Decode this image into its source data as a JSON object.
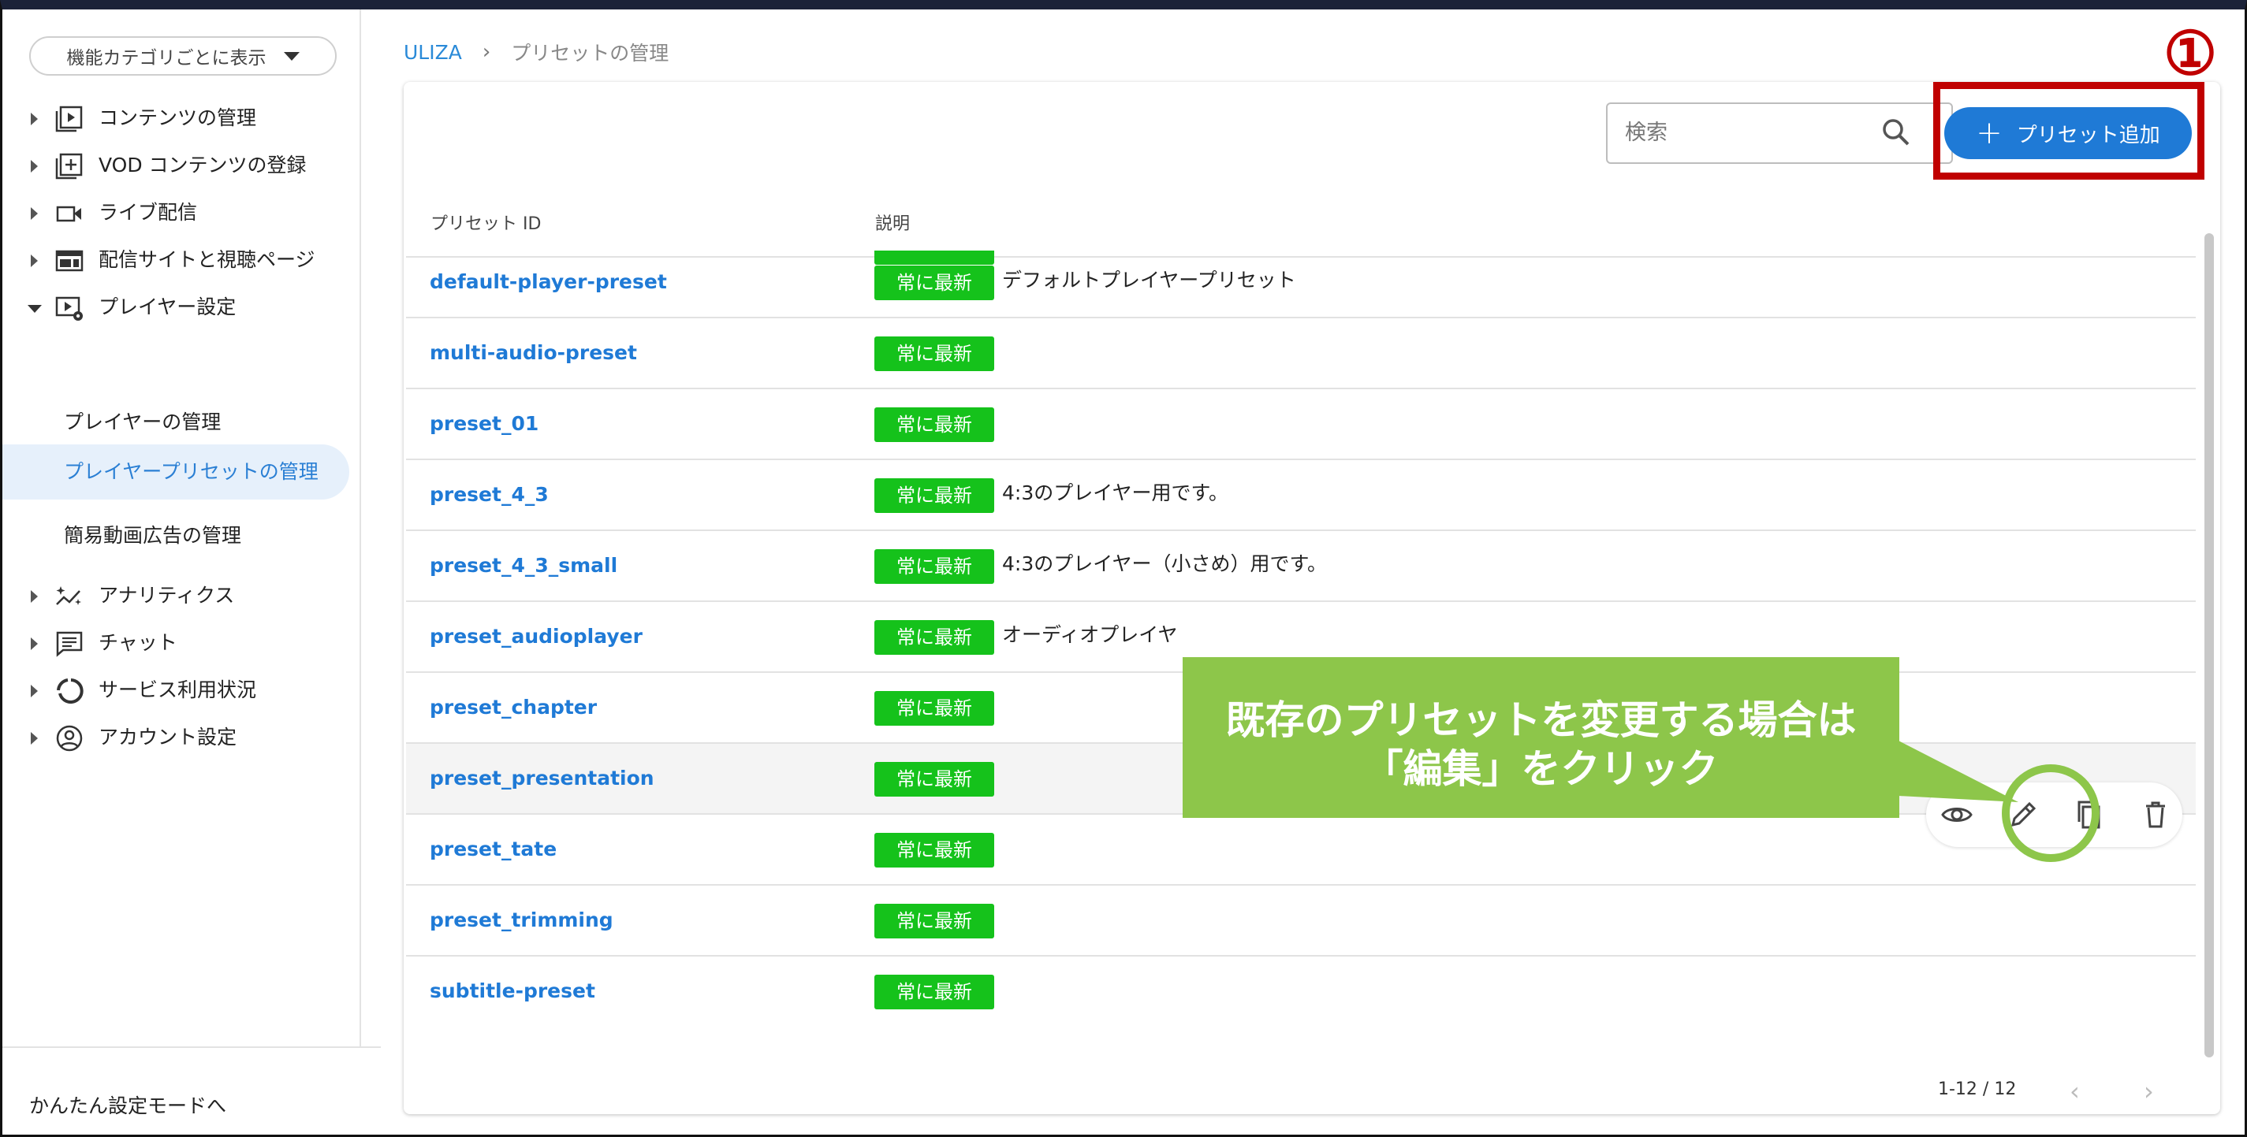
{
  "sidebar": {
    "category_select": "機能カテゴリごとに表示",
    "items": [
      {
        "label": "コンテンツの管理",
        "icon": "play-box-icon"
      },
      {
        "label": "VOD コンテンツの登録",
        "icon": "plus-box-icon"
      },
      {
        "label": "ライブ配信",
        "icon": "video-camera-icon"
      },
      {
        "label": "配信サイトと視聴ページ",
        "icon": "web-layout-icon"
      },
      {
        "label": "プレイヤー設定",
        "icon": "player-settings-icon"
      },
      {
        "label": "アナリティクス",
        "icon": "analytics-sparkle-icon"
      },
      {
        "label": "チャット",
        "icon": "chat-icon"
      },
      {
        "label": "サービス利用状況",
        "icon": "donut-chart-icon"
      },
      {
        "label": "アカウント設定",
        "icon": "account-circle-icon"
      }
    ],
    "sub_items": [
      "プレイヤーの管理",
      "プレイヤープリセットの管理",
      "簡易動画広告の管理"
    ],
    "footer": "かんたん設定モードへ"
  },
  "breadcrumb": {
    "home": "ULIZA",
    "separator": "›",
    "current": "プリセットの管理"
  },
  "toolbar": {
    "search_placeholder": "検索",
    "add_label": "プリセット追加"
  },
  "table": {
    "headers": [
      "プリセット ID",
      "説明"
    ],
    "tag_label": "常に最新",
    "rows": [
      {
        "id": "default-player-preset",
        "desc": "デフォルトプレイヤープリセット"
      },
      {
        "id": "multi-audio-preset",
        "desc": ""
      },
      {
        "id": "preset_01",
        "desc": ""
      },
      {
        "id": "preset_4_3",
        "desc": "4:3のプレイヤー用です。"
      },
      {
        "id": "preset_4_3_small",
        "desc": "4:3のプレイヤー（小さめ）用です。"
      },
      {
        "id": "preset_audioplayer",
        "desc": "オーディオプレイヤ"
      },
      {
        "id": "preset_chapter",
        "desc": ""
      },
      {
        "id": "preset_presentation",
        "desc": ""
      },
      {
        "id": "preset_tate",
        "desc": ""
      },
      {
        "id": "preset_trimming",
        "desc": ""
      },
      {
        "id": "subtitle-preset",
        "desc": ""
      }
    ]
  },
  "pagination": {
    "range": "1-12 / 12"
  },
  "annotations": {
    "marker": "①",
    "callout_line1": "既存のプリセットを変更する場合は",
    "callout_line2": "「編集」をクリック",
    "color_green": "#8dc64a",
    "color_red": "#c00000"
  }
}
